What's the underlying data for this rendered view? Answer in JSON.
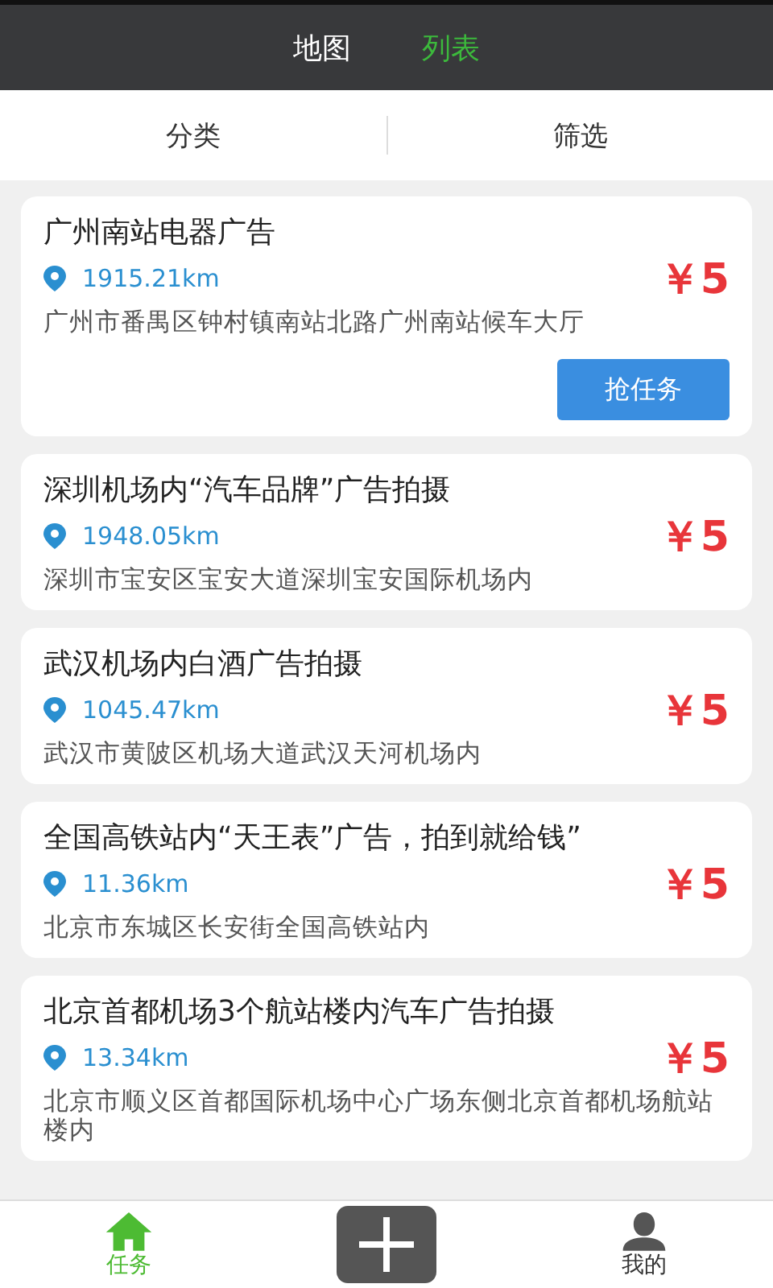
{
  "top_tabs": [
    {
      "label": "地图",
      "selected": false
    },
    {
      "label": "列表",
      "selected": true
    }
  ],
  "filters": [
    {
      "label": "分类"
    },
    {
      "label": "筛选"
    }
  ],
  "tasks": [
    {
      "title": "广州南站电器广告",
      "distance": "1915.21km",
      "address": "广州市番禺区钟村镇南站北路广州南站候车大厅",
      "price": "￥5",
      "button": "抢任务"
    },
    {
      "title": "深圳机场内“汽车品牌”广告拍摄",
      "distance": "1948.05km",
      "address": "深圳市宝安区宝安大道深圳宝安国际机场内",
      "price": "￥5"
    },
    {
      "title": "武汉机场内白酒广告拍摄",
      "distance": "1045.47km",
      "address": "武汉市黄陂区机场大道武汉天河机场内",
      "price": "￥5"
    },
    {
      "title": "全国高铁站内“天王表”广告，拍到就给钱”",
      "distance": "11.36km",
      "address": "北京市东城区长安街全国高铁站内",
      "price": "￥5"
    },
    {
      "title": "北京首都机场3个航站楼内汽车广告拍摄",
      "distance": "13.34km",
      "address": "北京市顺义区首都国际机场中心广场东侧北京首都机场航站楼内",
      "price": "￥5"
    }
  ],
  "bottom_nav": [
    {
      "kind": "home",
      "label": "任务",
      "selected": true
    },
    {
      "kind": "add",
      "selected": false
    },
    {
      "kind": "profile",
      "label": "我的",
      "selected": false
    }
  ]
}
